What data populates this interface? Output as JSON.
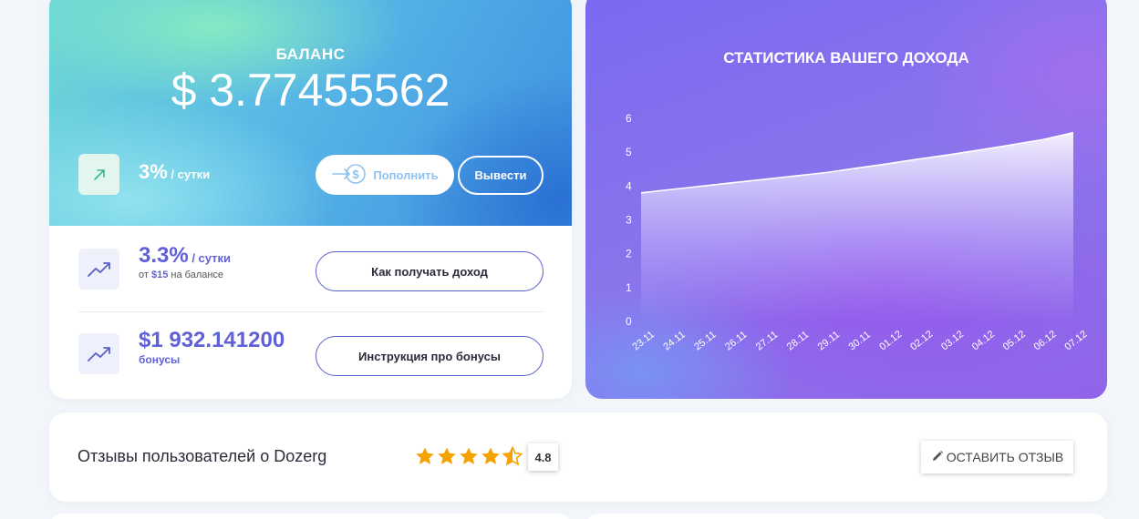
{
  "balance": {
    "label": "БАЛАНС",
    "value": "$ 3.77455562",
    "rate": "3%",
    "rate_unit": " / сутки",
    "deposit_label": "Пополнить",
    "withdraw_label": "Вывести"
  },
  "income": {
    "rate": "3.3%",
    "rate_unit": " / сутки",
    "min_prefix": "от ",
    "min_amount": "$15",
    "min_suffix": " на балансе",
    "how_button": "Как получать доход"
  },
  "bonus": {
    "amount": "$1 932.141200",
    "label": "бонусы",
    "instructions_button": "Инструкция про бонусы"
  },
  "chart_data": {
    "type": "area",
    "title": "СТАТИСТИКА ВАШЕГО ДОХОДА",
    "categories": [
      "23.11",
      "24.11",
      "25.11",
      "26.11",
      "27.11",
      "28.11",
      "29.11",
      "30.11",
      "01.12",
      "02.12",
      "03.12",
      "04.12",
      "05.12",
      "06.12",
      "07.12"
    ],
    "values": [
      3.8,
      3.9,
      4.0,
      4.1,
      4.2,
      4.3,
      4.4,
      4.53,
      4.66,
      4.8,
      4.93,
      5.07,
      5.22,
      5.37,
      5.58
    ],
    "ylim": [
      0,
      6
    ],
    "yticks": [
      "0",
      "1",
      "2",
      "3",
      "4",
      "5",
      "6"
    ],
    "grid": false,
    "colors": {
      "line": "#ffffff",
      "fill_top": "#ffffff",
      "fill_bottom": "#c9b8ff"
    }
  },
  "reviews": {
    "title": "Отзывы пользователей о Dozerg",
    "rating": "4.8",
    "stars": 4.8,
    "leave_review": "ОСТАВИТЬ ОТЗЫВ",
    "star_color": "#f5a300"
  }
}
